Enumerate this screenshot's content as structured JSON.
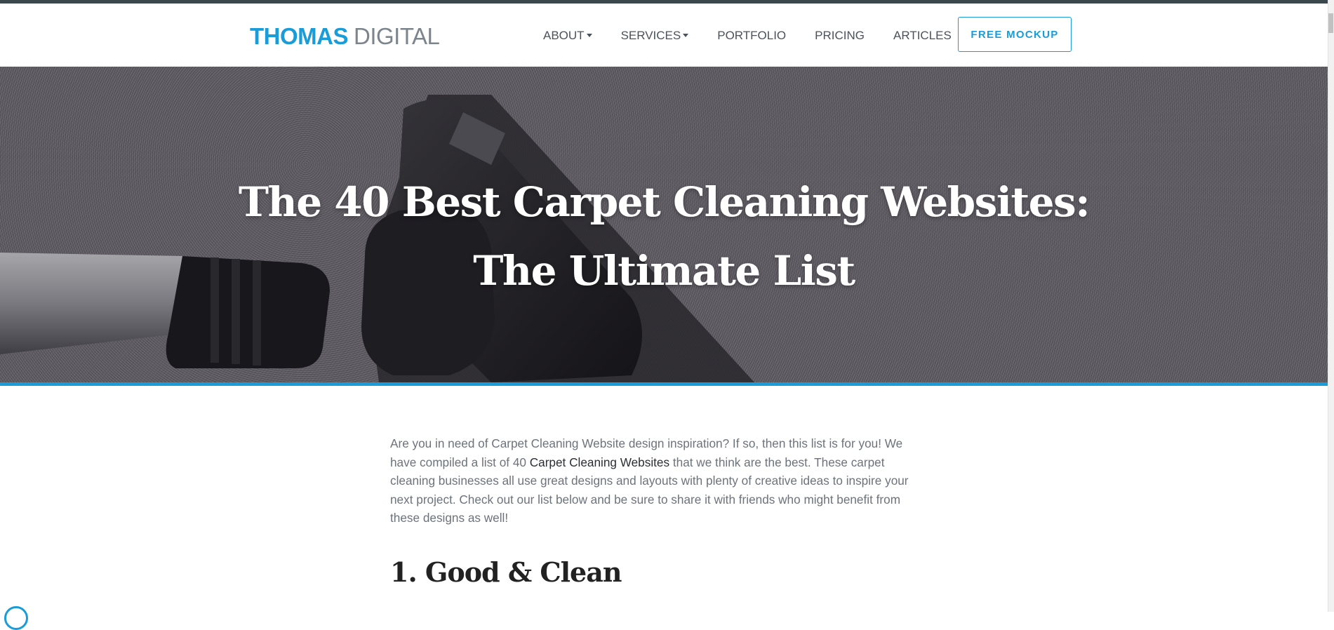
{
  "brand": {
    "name_bold": "THOMAS",
    "name_light": "DIGITAL"
  },
  "nav": {
    "items": [
      {
        "label": "ABOUT",
        "dropdown": true
      },
      {
        "label": "SERVICES",
        "dropdown": true
      },
      {
        "label": "PORTFOLIO",
        "dropdown": false
      },
      {
        "label": "PRICING",
        "dropdown": false
      },
      {
        "label": "ARTICLES",
        "dropdown": false
      }
    ],
    "cta_label": "FREE MOCKUP"
  },
  "hero": {
    "title_line1": "The 40 Best Carpet Cleaning Websites:",
    "title_line2": "The Ultimate List",
    "accent_color": "#1a9cd8"
  },
  "article": {
    "intro_before": "Are you in need of Carpet Cleaning Website design inspiration? If so, then this list is for you! We have compiled a list of 40 ",
    "intro_highlight": "Carpet Cleaning Websites",
    "intro_after": " that we think are the best. These carpet cleaning businesses all use great designs and layouts with plenty of creative ideas to inspire your next project. Check out our list below and be sure to share it with friends who might benefit from these designs as well!",
    "first_heading": "1. Good & Clean"
  },
  "icons": {
    "dropdown": "caret-down-icon",
    "chat": "chat-icon"
  }
}
